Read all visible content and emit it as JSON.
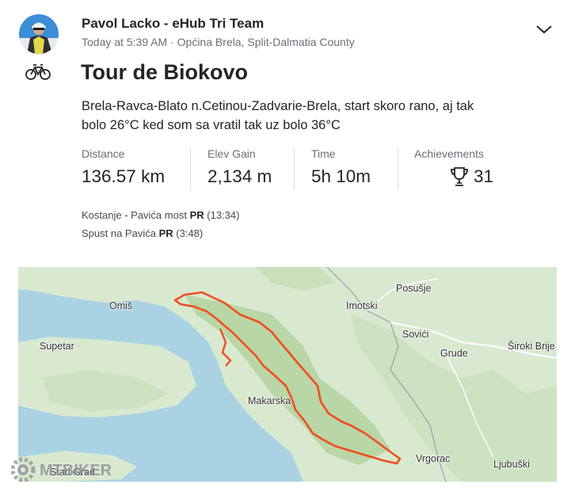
{
  "post": {
    "athlete_name": "Pavol Lacko - eHub Tri Team",
    "timestamp": "Today at 5:39 AM",
    "separator": "·",
    "location": "Općina Brela, Split-Dalmatia County",
    "activity_type_icon": "bike-icon",
    "title": "Tour de Biokovo",
    "description": "Brela-Ravca-Blato n.Cetinou-Zadvarie-Brela, start skoro rano, aj tak bolo 26°C ked som sa vratil tak uz bolo 36°C"
  },
  "stats": [
    {
      "label": "Distance",
      "value": "136.57 km"
    },
    {
      "label": "Elev Gain",
      "value": "2,134 m"
    },
    {
      "label": "Time",
      "value": "5h 10m"
    }
  ],
  "achievements": {
    "label": "Achievements",
    "count": "31",
    "icon": "trophy-icon"
  },
  "segments": [
    {
      "name": "Kostanje - Pavića most",
      "badge": "PR",
      "time": "(13:34)"
    },
    {
      "name": "Spust na Pavića",
      "badge": "PR",
      "time": "(3:48)"
    }
  ],
  "map": {
    "labels": {
      "posusje": "Posušje",
      "omis": "Omiš",
      "imotski": "Imotski",
      "sovici": "Sovići",
      "supetar": "Supetar",
      "grude": "Grude",
      "siroki": "Široki Brije",
      "makarska": "Makarska",
      "vrgorac": "Vrgorac",
      "ljubuski": "Ljubuški",
      "stari_grad": "Stari Grad"
    },
    "colors": {
      "sea": "#a9d3e3",
      "land": "#d8e9cf",
      "forest": "#b9d6a6",
      "route": "#f04e1f"
    }
  },
  "watermark": {
    "text": "MTBIKER"
  }
}
